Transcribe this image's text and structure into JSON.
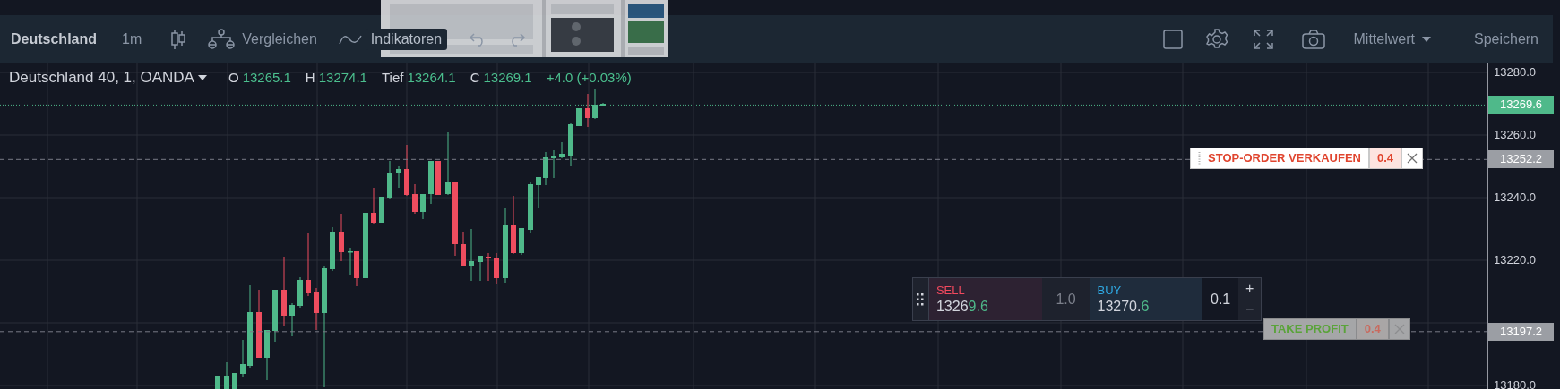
{
  "toolbar": {
    "symbol": "Deutschland",
    "interval": "1m",
    "compare": "Vergleichen",
    "indicators": "Indikatoren",
    "price_type": "Mittelwert",
    "save": "Speichern"
  },
  "legend": {
    "title": "Deutschland 40, 1, OANDA",
    "values": [
      {
        "label": "O",
        "value": "13265.1"
      },
      {
        "label": "H",
        "value": "13274.1"
      },
      {
        "label": "Tief",
        "value": "13264.1"
      },
      {
        "label": "C",
        "value": "13269.1"
      }
    ],
    "change": "+4.0 (+0.03%)"
  },
  "price_axis": {
    "ticks": [
      "13280.0",
      "13260.0",
      "13240.0",
      "13220.0",
      "13180.0"
    ],
    "markers": [
      {
        "kind": "last",
        "text": "13269.6"
      },
      {
        "kind": "order",
        "text": "13252.2"
      },
      {
        "kind": "order",
        "text": "13197.2"
      }
    ]
  },
  "orders": [
    {
      "kind": "stop",
      "label": "STOP-ORDER VERKAUFEN",
      "qty": "0.4"
    },
    {
      "kind": "take_profit",
      "label": "TAKE PROFIT",
      "qty": "0.4"
    }
  ],
  "trade_panel": {
    "sell": {
      "label": "SELL",
      "price_main": "1326",
      "price_pips": "9.6"
    },
    "quantity": "1.0",
    "buy": {
      "label": "BUY",
      "price_main": "13270.",
      "price_pips": "6"
    },
    "step": "0.1",
    "plus": "+",
    "minus": "−"
  }
}
